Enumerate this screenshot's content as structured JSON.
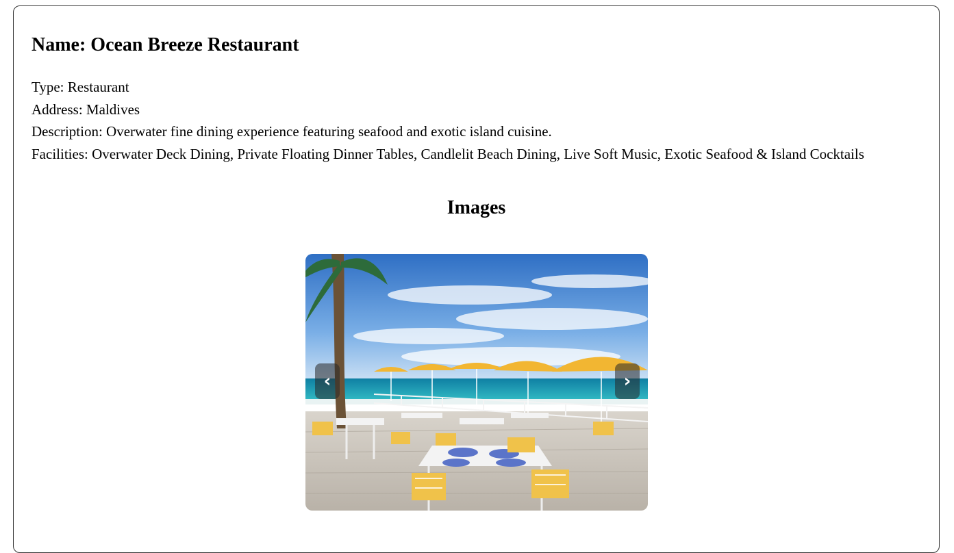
{
  "place": {
    "name_label": "Name: Ocean Breeze Restaurant",
    "type_label": "Type: Restaurant",
    "address_label": "Address: Maldives",
    "description_label": "Description: Overwater fine dining experience featuring seafood and exotic island cuisine.",
    "facilities_label": "Facilities: Overwater Deck Dining, Private Floating Dinner Tables, Candlelit Beach Dining, Live Soft Music, Exotic Seafood & Island Cocktails"
  },
  "gallery": {
    "heading": "Images",
    "prev_icon": "chevron-left-icon",
    "next_icon": "chevron-right-icon",
    "prev_glyph": "‹",
    "next_glyph": "›"
  },
  "colors": {
    "border": "#333333",
    "nav_button_bg": "rgba(40,40,40,0.55)",
    "umbrella_yellow": "#f2b632",
    "sky_blue": "#3f7fd0",
    "sea_teal": "#1fa5b8"
  }
}
